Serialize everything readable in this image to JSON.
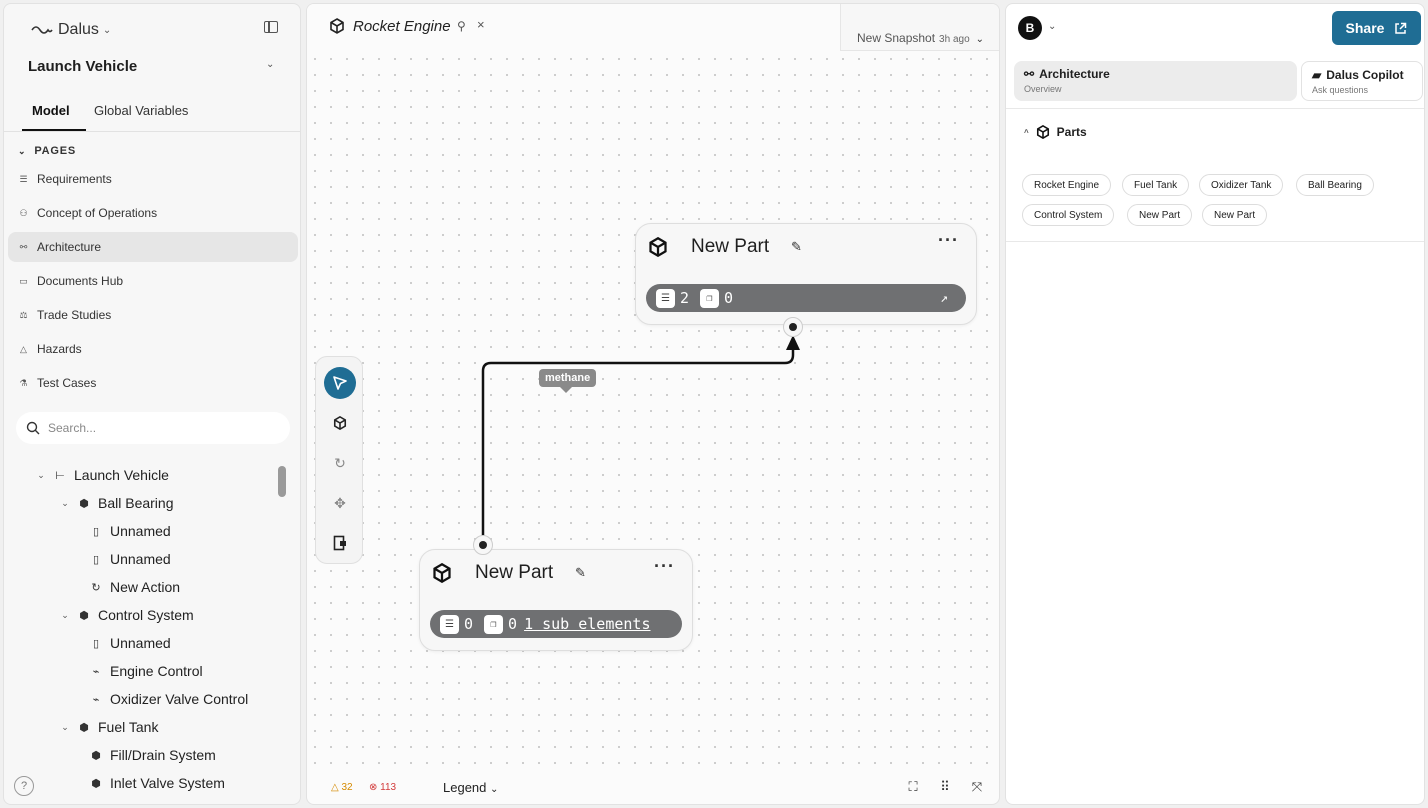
{
  "sidebar": {
    "brand": "Dalus",
    "project": "Launch Vehicle",
    "tabs": [
      "Model",
      "Global Variables"
    ],
    "pages_header": "PAGES",
    "pages": [
      {
        "label": "Requirements",
        "icon": "list-icon"
      },
      {
        "label": "Concept of Operations",
        "icon": "users-icon"
      },
      {
        "label": "Architecture",
        "icon": "share-nodes-icon",
        "active": true
      },
      {
        "label": "Documents Hub",
        "icon": "folder-icon"
      },
      {
        "label": "Trade Studies",
        "icon": "scale-icon"
      },
      {
        "label": "Hazards",
        "icon": "warning-icon"
      },
      {
        "label": "Test Cases",
        "icon": "flask-icon"
      }
    ],
    "search_placeholder": "Search...",
    "tree": [
      {
        "label": "Launch Vehicle",
        "level": 0,
        "icon": "tree-icon"
      },
      {
        "label": "Ball Bearing",
        "level": 1,
        "icon": "cube-icon"
      },
      {
        "label": "Unnamed",
        "level": 2,
        "icon": "port-icon"
      },
      {
        "label": "Unnamed",
        "level": 2,
        "icon": "port-icon"
      },
      {
        "label": "New Action",
        "level": 2,
        "icon": "refresh-icon"
      },
      {
        "label": "Control System",
        "level": 1,
        "icon": "cube-icon"
      },
      {
        "label": "Unnamed",
        "level": 2,
        "icon": "port-icon"
      },
      {
        "label": "Engine Control",
        "level": 2,
        "icon": "plug-icon"
      },
      {
        "label": "Oxidizer Valve Control",
        "level": 2,
        "icon": "plug-icon"
      },
      {
        "label": "Fuel Tank",
        "level": 1,
        "icon": "cube-icon"
      },
      {
        "label": "Fill/Drain System",
        "level": 2,
        "icon": "cube-icon"
      },
      {
        "label": "Inlet Valve System",
        "level": 2,
        "icon": "cube-icon"
      }
    ],
    "help": "?"
  },
  "center": {
    "tab_title": "Rocket Engine",
    "snapshot_label": "New Snapshot",
    "snapshot_time": "3h ago",
    "nodes": [
      {
        "title": "New Part",
        "req_count": "2",
        "copy_count": "0"
      },
      {
        "title": "New Part",
        "req_count": "0",
        "copy_count": "0",
        "sub_elements": "1 sub elements"
      }
    ],
    "edge_label": "methane",
    "warnings": "32",
    "errors": "113",
    "legend": "Legend"
  },
  "right": {
    "avatar": "B",
    "share": "Share",
    "tabs": [
      {
        "title": "Architecture",
        "sub": "Overview"
      },
      {
        "title": "Dalus Copilot",
        "sub": "Ask questions"
      }
    ],
    "parts_header": "Parts",
    "parts": [
      "Rocket Engine",
      "Fuel Tank",
      "Oxidizer Tank",
      "Ball Bearing",
      "Control System",
      "New Part",
      "New Part"
    ]
  },
  "colors": {
    "accent": "#1f6d94",
    "warning": "#d48a00",
    "error": "#d23b3b",
    "node_bar": "#6f7072"
  }
}
